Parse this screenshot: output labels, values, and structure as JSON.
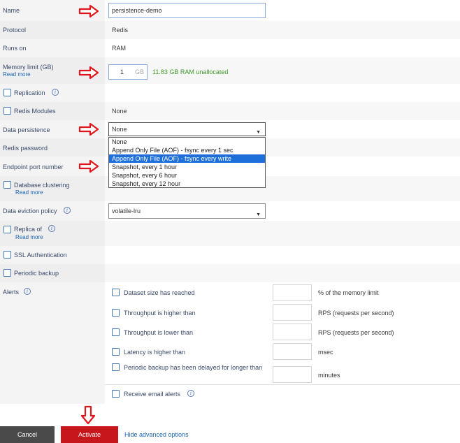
{
  "form": {
    "name": {
      "label": "Name",
      "value": "persistence-demo"
    },
    "protocol": {
      "label": "Protocol",
      "value": "Redis"
    },
    "runs_on": {
      "label": "Runs on",
      "value": "RAM"
    },
    "memory": {
      "label": "Memory limit (GB)",
      "read_more": "Read more",
      "value": "1",
      "unit": "GB",
      "note": "11.83 GB RAM unallocated"
    },
    "replication": {
      "label": "Replication"
    },
    "redis_modules": {
      "label": "Redis Modules",
      "value": "None"
    },
    "data_persistence": {
      "label": "Data persistence",
      "selected": "None",
      "options": [
        "None",
        "Append Only File (AOF) - fsync every 1 sec",
        "Append Only File (AOF) - fsync every write",
        "Snapshot, every 1 hour",
        "Snapshot, every 6 hour",
        "Snapshot, every 12 hour"
      ],
      "highlighted_index": 2
    },
    "redis_password": {
      "label": "Redis password"
    },
    "endpoint_port": {
      "label": "Endpoint port number"
    },
    "clustering": {
      "label": "Database clustering",
      "read_more": "Read more"
    },
    "eviction": {
      "label": "Data eviction policy",
      "selected": "volatile-lru"
    },
    "replica_of": {
      "label": "Replica of",
      "read_more": "Read more"
    },
    "ssl": {
      "label": "SSL Authentication"
    },
    "periodic_backup": {
      "label": "Periodic backup"
    },
    "alerts": {
      "label": "Alerts",
      "items": [
        {
          "label": "Dataset size has reached",
          "unit": "% of the memory limit"
        },
        {
          "label": "Throughput is higher than",
          "unit": "RPS (requests per second)"
        },
        {
          "label": "Throughput is lower than",
          "unit": "RPS (requests per second)"
        },
        {
          "label": "Latency is higher than",
          "unit": "msec"
        },
        {
          "label": "Periodic backup has been delayed for longer than",
          "unit": "minutes"
        }
      ],
      "email": "Receive email alerts"
    }
  },
  "footer": {
    "cancel": "Cancel",
    "activate": "Activate",
    "hide_advanced": "Hide advanced options"
  },
  "colors": {
    "activate_button": "#c8161d",
    "cancel_button": "#4a4a4a",
    "annotation_arrow": "#e0161d",
    "dropdown_highlight": "#1e6fd9",
    "unallocated_note": "#3f9a2a"
  }
}
